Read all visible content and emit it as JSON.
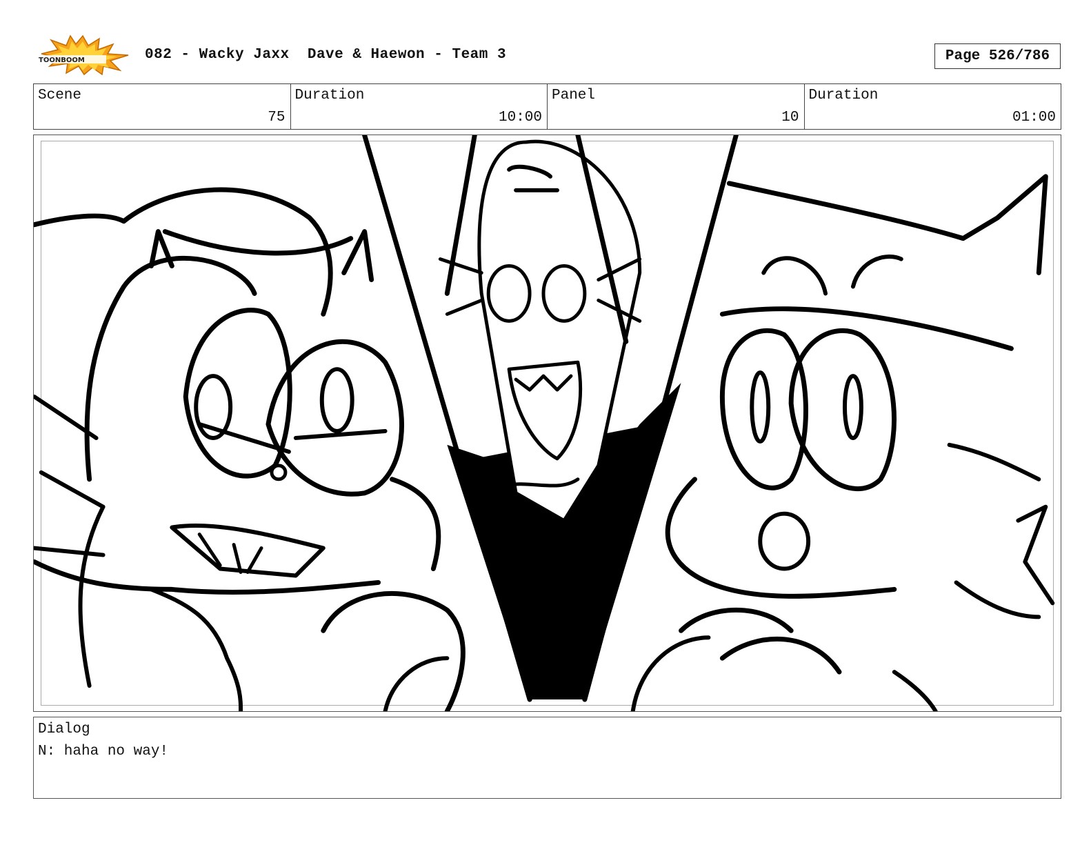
{
  "header": {
    "logo_text": "TOONBOOM",
    "title": "082 - Wacky Jaxx  Dave & Haewon - Team 3",
    "page": "Page 526/786"
  },
  "info": {
    "scene_label": "Scene",
    "scene_value": "75",
    "scene_duration_label": "Duration",
    "scene_duration_value": "10:00",
    "panel_label": "Panel",
    "panel_value": "10",
    "panel_duration_label": "Duration",
    "panel_duration_value": "01:00"
  },
  "dialog": {
    "label": "Dialog",
    "text": "N: haha no way!"
  }
}
